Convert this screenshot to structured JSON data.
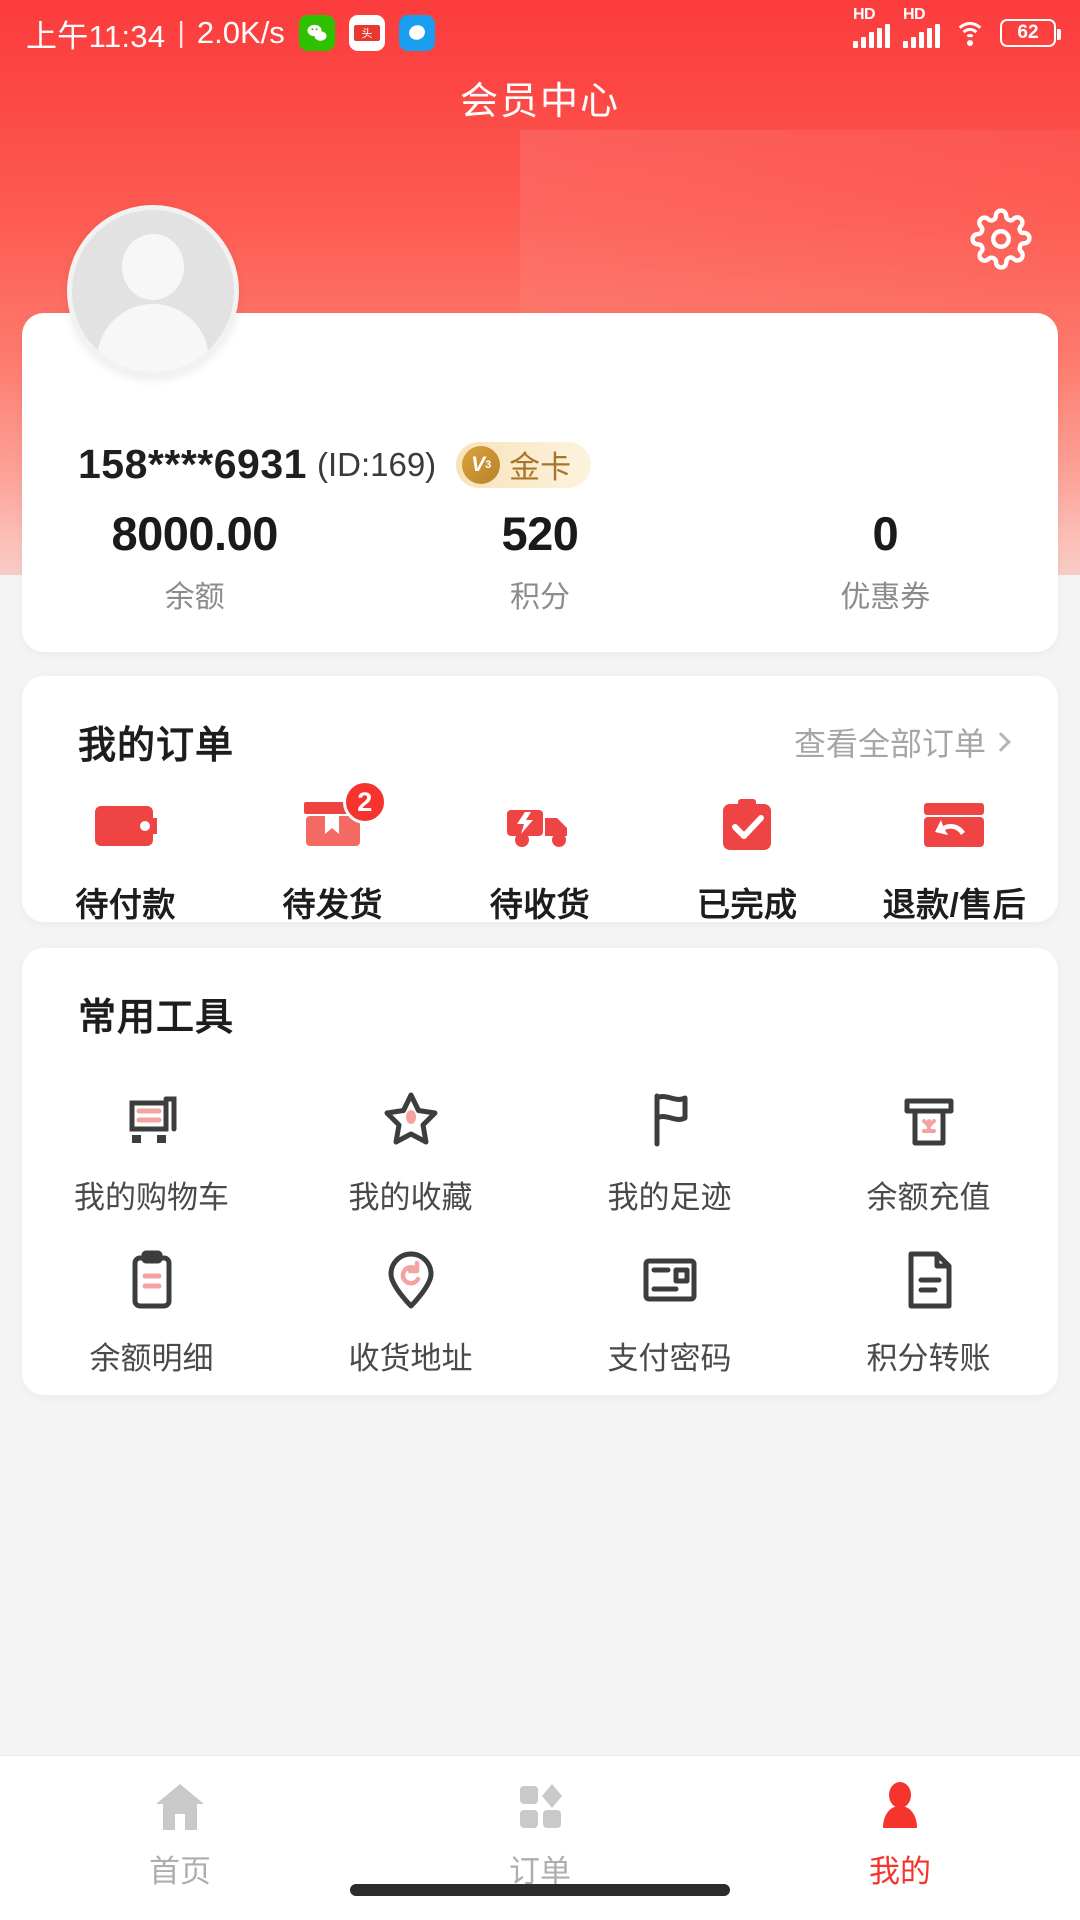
{
  "status_bar": {
    "time": "上午11:34",
    "divider": "|",
    "net_speed": "2.0K/s",
    "app_icons": [
      "wechat-icon",
      "toutiao-icon",
      "messenger-icon"
    ],
    "signal_label_1": "HD",
    "signal_label_2": "HD",
    "wifi": "wifi-icon",
    "battery_percent": "62"
  },
  "header": {
    "title": "会员中心",
    "settings_icon": "gear-icon",
    "accent_color": "#fb3c3c"
  },
  "profile": {
    "avatar": "avatar-placeholder-icon",
    "phone": "158****6931",
    "user_id": "(ID:169)",
    "level_badge": {
      "medal": "V",
      "medal_sub": "3",
      "label": "金卡",
      "color": "#a8762a"
    },
    "stats": [
      {
        "value": "8000.00",
        "label": "余额"
      },
      {
        "value": "520",
        "label": "积分"
      },
      {
        "value": "0",
        "label": "优惠券"
      }
    ]
  },
  "orders": {
    "title": "我的订单",
    "more_label": "查看全部订单",
    "more_icon": "chevron-right-icon",
    "items": [
      {
        "label": "待付款",
        "icon": "wallet-icon",
        "badge": ""
      },
      {
        "label": "待发货",
        "icon": "package-box-icon",
        "badge": "2"
      },
      {
        "label": "待收货",
        "icon": "delivery-truck-icon",
        "badge": ""
      },
      {
        "label": "已完成",
        "icon": "clipboard-check-icon",
        "badge": ""
      },
      {
        "label": "退款/售后",
        "icon": "refund-return-icon",
        "badge": ""
      }
    ]
  },
  "tools": {
    "title": "常用工具",
    "items": [
      {
        "label": "我的购物车",
        "icon": "shopping-cart-icon"
      },
      {
        "label": "我的收藏",
        "icon": "star-favorite-icon"
      },
      {
        "label": "我的足迹",
        "icon": "flag-footprint-icon"
      },
      {
        "label": "余额充值",
        "icon": "atm-recharge-icon"
      },
      {
        "label": "余额明细",
        "icon": "clipboard-list-icon"
      },
      {
        "label": "收货地址",
        "icon": "location-pin-icon"
      },
      {
        "label": "支付密码",
        "icon": "card-password-icon"
      },
      {
        "label": "积分转账",
        "icon": "document-transfer-icon"
      }
    ]
  },
  "tabbar": {
    "items": [
      {
        "label": "首页",
        "icon": "home-icon",
        "active": false
      },
      {
        "label": "订单",
        "icon": "grid-orders-icon",
        "active": false
      },
      {
        "label": "我的",
        "icon": "person-icon",
        "active": true
      }
    ],
    "active_color": "#f5342e"
  }
}
